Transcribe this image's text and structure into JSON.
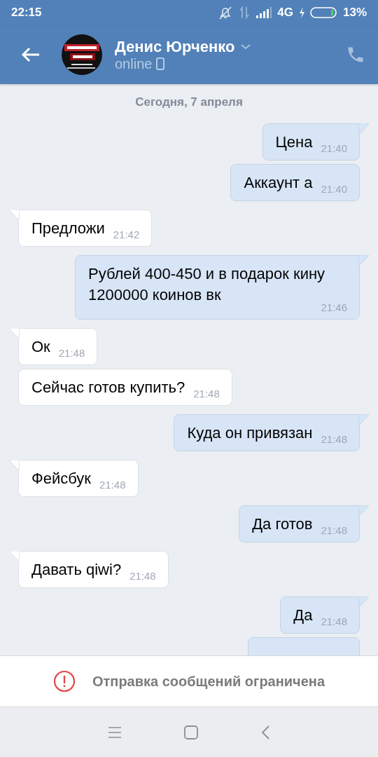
{
  "status_bar": {
    "time": "22:15",
    "network": "4G",
    "battery_text": "13%"
  },
  "header": {
    "name": "Денис Юрченко",
    "status": "online"
  },
  "date_divider": "Сегодня, 7 апреля",
  "messages": [
    {
      "outgoing": true,
      "kind": "text",
      "text": "Цена",
      "time": "21:40"
    },
    {
      "outgoing": true,
      "kind": "text",
      "text": "Аккаунт а",
      "time": "21:40"
    },
    {
      "outgoing": false,
      "kind": "text",
      "text": "Предложи",
      "time": "21:42"
    },
    {
      "outgoing": true,
      "kind": "text",
      "text": "Рублей 400-450 и в подарок кину 1200000 коинов вк",
      "time": "21:46"
    },
    {
      "outgoing": false,
      "kind": "text",
      "text": "Ок",
      "time": "21:48"
    },
    {
      "outgoing": false,
      "kind": "text",
      "text": "Сейчас готов купить?",
      "time": "21:48"
    },
    {
      "outgoing": true,
      "kind": "text",
      "text": "Куда он привязан",
      "time": "21:48"
    },
    {
      "outgoing": false,
      "kind": "text",
      "text": "Фейсбук",
      "time": "21:48"
    },
    {
      "outgoing": true,
      "kind": "text",
      "text": "Да готов",
      "time": "21:48"
    },
    {
      "outgoing": false,
      "kind": "text",
      "text": "Давать qiwi?",
      "time": "21:48"
    },
    {
      "outgoing": true,
      "kind": "text",
      "text": "Да",
      "time": "21:48"
    },
    {
      "outgoing": true,
      "kind": "cut"
    }
  ],
  "notice": {
    "text": "Отправка сообщений ограничена"
  }
}
